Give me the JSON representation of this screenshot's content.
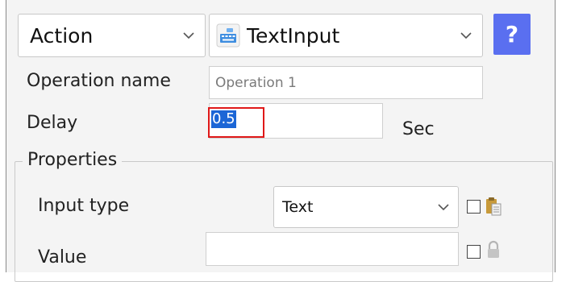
{
  "header": {
    "category_value": "Action",
    "operation_type_value": "TextInput",
    "help_label": "?"
  },
  "fields": {
    "operation_name_label": "Operation name",
    "operation_name_placeholder": "Operation 1",
    "delay_label": "Delay",
    "delay_value": "0.5",
    "delay_unit": "Sec"
  },
  "properties": {
    "title": "Properties",
    "input_type_label": "Input type",
    "input_type_value": "Text",
    "value_label": "Value",
    "value_value": ""
  },
  "colors": {
    "help_button": "#5a6ff0",
    "focus_border": "#e01818",
    "selection": "#1c66d6"
  },
  "icons": {
    "textinput": "keyboard-icon",
    "clipboard": "clipboard-icon",
    "lock": "lock-icon"
  }
}
